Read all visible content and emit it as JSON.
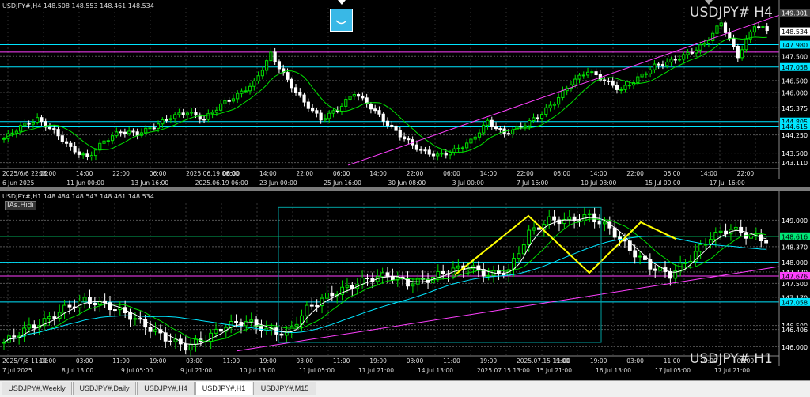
{
  "top_chart": {
    "info": "USDJPY#,H4  148.508 148.553 148.461 148.534",
    "watermark": "USDJPY# H4",
    "price_labels": [
      {
        "text": "149.301",
        "y": 149.301,
        "bg": "#404040",
        "fg": "#ffffff"
      },
      {
        "text": "148.534",
        "y": 148.534,
        "bg": "#ffffff",
        "fg": "#000000"
      },
      {
        "text": "147.980",
        "y": 147.98,
        "bg": "#00e5ff",
        "fg": "#000000"
      },
      {
        "text": "147.500",
        "y": 147.5,
        "bg": "#000000",
        "fg": "#ffffff"
      },
      {
        "text": "147.058",
        "y": 147.058,
        "bg": "#00e5ff",
        "fg": "#000000"
      },
      {
        "text": "146.500",
        "y": 146.5,
        "bg": "#000000",
        "fg": "#ffffff"
      },
      {
        "text": "146.000",
        "y": 146.0,
        "bg": "#000000",
        "fg": "#ffffff"
      },
      {
        "text": "145.375",
        "y": 145.375,
        "bg": "#000000",
        "fg": "#ffffff"
      },
      {
        "text": "144.805",
        "y": 144.805,
        "bg": "#00e5ff",
        "fg": "#000000"
      },
      {
        "text": "144.615",
        "y": 144.615,
        "bg": "#00e5ff",
        "fg": "#000000"
      },
      {
        "text": "144.250",
        "y": 144.25,
        "bg": "#000000",
        "fg": "#ffffff"
      },
      {
        "text": "143.500",
        "y": 143.5,
        "bg": "#000000",
        "fg": "#ffffff"
      },
      {
        "text": "143.110",
        "y": 143.11,
        "bg": "#000000",
        "fg": "#ffffff"
      }
    ],
    "time_labels_row1": [
      "2025/6/6 22:00",
      "06:00",
      "14:00",
      "22:00",
      "06:00",
      "2025.06.19 06:00",
      "06:00",
      "14:00",
      "22:00",
      "06:00",
      "14:00",
      "22:00",
      "06:00",
      "14:00",
      "22:00",
      "06:00",
      "14:00",
      "22:00",
      "06:00",
      "14:00",
      "22:00"
    ],
    "time_labels_row2": [
      "6 Jun 2025",
      "11 Jun 00:00",
      "13 Jun 16:00",
      "2025.06.19 06:00",
      "23 Jun 00:00",
      "25 Jun 16:00",
      "30 Jun 08:00",
      "3 Jul 00:00",
      "7 Jul 16:00",
      "10 Jul 08:00",
      "15 Jul 00:00",
      "17 Jul 16:00"
    ]
  },
  "bottom_chart": {
    "info": "USDJPY#,H1  148.484 148.543 148.461 148.534",
    "indicator_label": "IAs.Hidi",
    "watermark": "USDJPY# H1",
    "price_labels": [
      {
        "text": "149.000",
        "y": 149.0,
        "bg": "#000000",
        "fg": "#ffffff"
      },
      {
        "text": "148.616",
        "y": 148.616,
        "bg": "#00e676",
        "fg": "#000000"
      },
      {
        "text": "148.370",
        "y": 148.37,
        "bg": "#000000",
        "fg": "#ffffff"
      },
      {
        "text": "148.000",
        "y": 148.0,
        "bg": "#000000",
        "fg": "#ffffff"
      },
      {
        "text": "147.770",
        "y": 147.77,
        "bg": "#000000",
        "fg": "#ffffff"
      },
      {
        "text": "147.676",
        "y": 147.676,
        "bg": "#ff40ff",
        "fg": "#000000"
      },
      {
        "text": "147.500",
        "y": 147.5,
        "bg": "#000000",
        "fg": "#ffffff"
      },
      {
        "text": "147.170",
        "y": 147.17,
        "bg": "#000000",
        "fg": "#ffffff"
      },
      {
        "text": "147.058",
        "y": 147.058,
        "bg": "#00e5ff",
        "fg": "#000000"
      },
      {
        "text": "146.500",
        "y": 146.5,
        "bg": "#000000",
        "fg": "#ffffff"
      },
      {
        "text": "146.406",
        "y": 146.406,
        "bg": "#000000",
        "fg": "#ffffff"
      },
      {
        "text": "146.000",
        "y": 146.0,
        "bg": "#000000",
        "fg": "#ffffff"
      }
    ],
    "time_labels": [
      "7 Jul 2025",
      "8 Jul 13:00",
      "9 Jul 05:00",
      "9 Jul 21:00",
      "10 Jul 13:00",
      "11 Jul 05:00",
      "11 Jul 21:00",
      "14 Jul 13:00",
      "2025.07.15 13:00",
      "15 Jul 21:00",
      "16 Jul 13:00",
      "17 Jul 05:00",
      "17 Jul 21:00"
    ],
    "time_labels_top": [
      "2025/7/8 11:00",
      "19:00",
      "03:00",
      "11:00",
      "19:00",
      "03:00",
      "11:00",
      "19:00",
      "03:00",
      "11:00",
      "19:00",
      "03:00",
      "11:00",
      "19:00",
      "2025.07.15 19:00",
      "11:00",
      "19:00",
      "03:00",
      "11:00",
      "19:00",
      "03:00"
    ]
  },
  "tabs": [
    {
      "label": "USDJPY#,Weekly",
      "active": false
    },
    {
      "label": "USDJPY#,Daily",
      "active": false
    },
    {
      "label": "USDJPY#,H4",
      "active": false
    },
    {
      "label": "USDJPY#,H1",
      "active": true
    },
    {
      "label": "USDJPY#,M15",
      "active": false
    }
  ],
  "chart_data": [
    {
      "type": "candlestick",
      "title": "USDJPY# H4",
      "ylim": [
        142.9,
        149.5
      ],
      "grid": true,
      "moving_average_color": "#00e000",
      "trendline_color": "#ff40ff",
      "horizontal_lines": [
        {
          "y": 147.98,
          "color": "#00e5ff"
        },
        {
          "y": 147.676,
          "color": "#ff40ff"
        },
        {
          "y": 147.058,
          "color": "#00e5ff"
        },
        {
          "y": 144.805,
          "color": "#00e5ff"
        },
        {
          "y": 144.615,
          "color": "#00e5ff"
        }
      ],
      "close_path": [
        144.1,
        144.6,
        144.9,
        144.4,
        143.7,
        143.3,
        144.0,
        144.4,
        144.3,
        144.6,
        145.0,
        145.2,
        144.9,
        145.5,
        145.9,
        146.4,
        147.6,
        146.5,
        145.6,
        144.9,
        145.3,
        146.0,
        145.4,
        144.7,
        144.1,
        143.6,
        143.4,
        143.6,
        144.0,
        144.8,
        144.3,
        144.6,
        145.0,
        145.6,
        146.4,
        146.9,
        146.5,
        146.1,
        146.6,
        147.1,
        147.3,
        147.6,
        148.0,
        148.9,
        147.5,
        148.8,
        148.5
      ]
    },
    {
      "type": "candlestick",
      "title": "USDJPY# H1",
      "ylim": [
        145.8,
        149.4
      ],
      "grid": true,
      "moving_average_colors": [
        "#00e000",
        "#00e5ff",
        "#ffffff"
      ],
      "zigzag_color": "#ffff00",
      "horizontal_lines": [
        {
          "y": 148.616,
          "color": "#00e676"
        },
        {
          "y": 148.0,
          "color": "#00e5ff"
        },
        {
          "y": 147.676,
          "color": "#ff40ff"
        },
        {
          "y": 147.058,
          "color": "#00e5ff"
        }
      ],
      "close_path": [
        146.1,
        146.4,
        146.6,
        146.9,
        147.1,
        147.0,
        146.8,
        146.5,
        146.2,
        146.0,
        146.2,
        146.5,
        146.6,
        146.4,
        146.3,
        146.9,
        147.2,
        147.4,
        147.6,
        147.7,
        147.5,
        147.6,
        147.8,
        147.9,
        147.7,
        147.8,
        148.7,
        149.0,
        149.0,
        149.1,
        148.8,
        148.3,
        147.9,
        147.7,
        148.1,
        148.6,
        148.8,
        148.6,
        148.5
      ]
    }
  ]
}
